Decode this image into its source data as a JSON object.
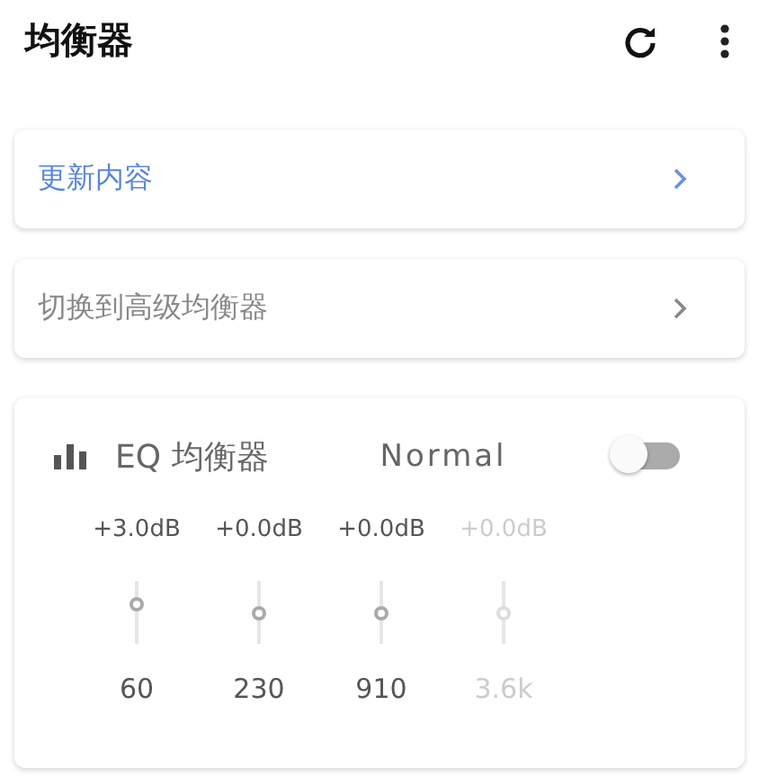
{
  "app_bar": {
    "title": "均衡器"
  },
  "nav_items": [
    {
      "label": "更新内容",
      "kind": "accent"
    },
    {
      "label": "切换到高级均衡器",
      "kind": "plain"
    }
  ],
  "equalizer": {
    "title": "EQ 均衡器",
    "preset": "Normal",
    "on": false,
    "bands": [
      {
        "gain": "+3.0dB",
        "level": 0.62,
        "frequency": "60",
        "disabled": false
      },
      {
        "gain": "+0.0dB",
        "level": 0.5,
        "frequency": "230",
        "disabled": false
      },
      {
        "gain": "+0.0dB",
        "level": 0.5,
        "frequency": "910",
        "disabled": false
      },
      {
        "gain": "+0.0dB",
        "level": 0.5,
        "frequency": "3.6k",
        "disabled": true
      }
    ]
  }
}
